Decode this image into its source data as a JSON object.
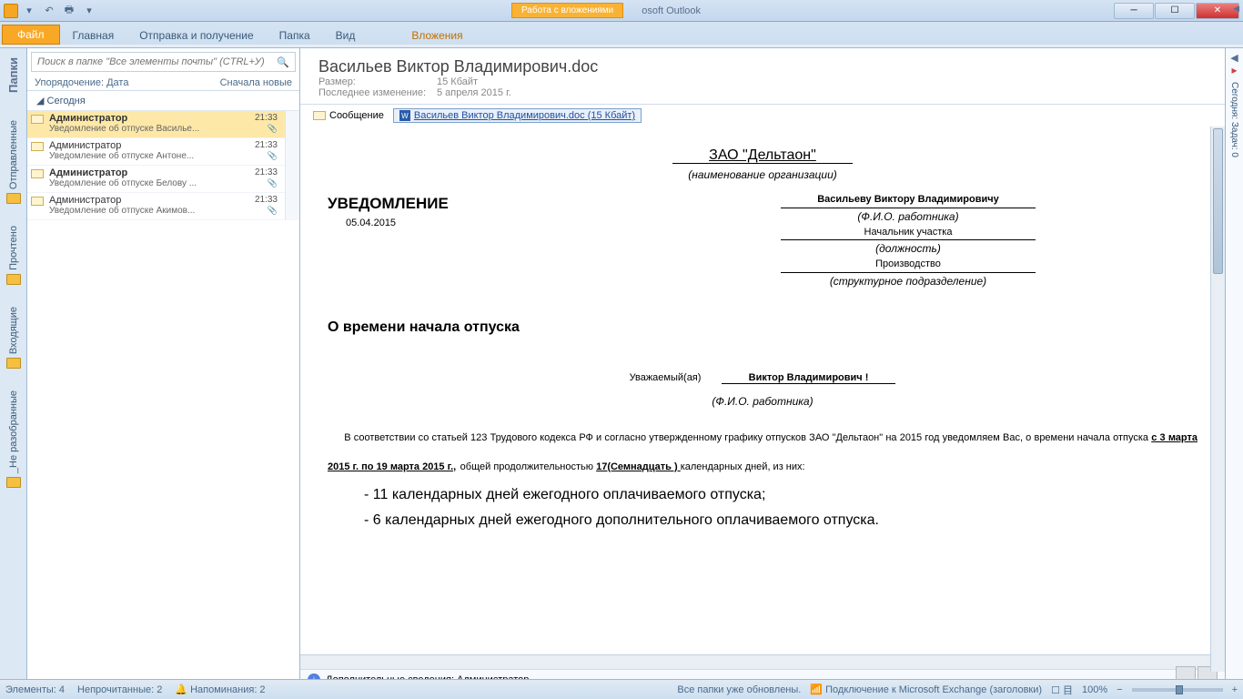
{
  "titlebar": {
    "attach_context": "Работа с вложениями",
    "window_title_suffix": "osoft Outlook"
  },
  "ribbon": {
    "file": "Файл",
    "home": "Главная",
    "sendrecv": "Отправка и получение",
    "folder": "Папка",
    "view": "Вид",
    "attachments": "Вложения"
  },
  "leftbar": {
    "header": "Папки",
    "items": [
      "Отправленные",
      "Прочтено",
      "Входящие",
      "_Не разобранные"
    ]
  },
  "midpane": {
    "search_placeholder": "Поиск в папке \"Все элементы почты\" (CTRL+У)",
    "sort_label": "Упорядочение: Дата",
    "sort_order": "Сначала новые",
    "group": "Сегодня",
    "messages": [
      {
        "from": "Администратор",
        "time": "21:33",
        "subj": "Уведомление об отпуске Василье...",
        "unread": true,
        "selected": true
      },
      {
        "from": "Администратор",
        "time": "21:33",
        "subj": "Уведомление об отпуске Антоне...",
        "unread": false
      },
      {
        "from": "Администратор",
        "time": "21:33",
        "subj": "Уведомление об отпуске Белову ...",
        "unread": true
      },
      {
        "from": "Администратор",
        "time": "21:33",
        "subj": "Уведомление об отпуске Акимов...",
        "unread": false
      }
    ]
  },
  "reading": {
    "title": "Васильев Виктор Владимирович.doc",
    "size_label": "Размер:",
    "size_value": "15 Кбайт",
    "mod_label": "Последнее изменение:",
    "mod_value": "5 апреля 2015 г.",
    "msg_btn": "Сообщение",
    "attachment": "Васильев Виктор Владимирович.doc (15 Кбайт)",
    "info": "Дополнительные сведения: Администратор."
  },
  "doc": {
    "org": "ЗАО \"Дельтаон\"",
    "org_caption": "(наименование организации)",
    "notice": "УВЕДОМЛЕНИЕ",
    "date": "05.04.2015",
    "to_name": "Васильеву Виктору Владимировичу",
    "to_name_cap": "(Ф.И.О. работника)",
    "position": "Начальник участка",
    "position_cap": "(должность)",
    "dept": "Производство",
    "dept_cap": "(структурное подразделение)",
    "subject": "О времени начала отпуска",
    "greeting": "Уважаемый(ая)",
    "greet_name": "Виктор Владимирович  !",
    "greet_cap": "(Ф.И.О. работника)",
    "body1": "В соответствии со статьей 123 Трудового кодекса РФ  и  согласно утвержденному графику  отпусков  ЗАО \"Дельтаон\"  на 2015 год  уведомляем  Вас, о   времени   начала  отпуска ",
    "period": "с  3  марта  2015 г.    по  19 марта 2015 г.,",
    "body2": " общей продолжительностью ",
    "duration": "  17(Семнадцать )  ",
    "body3": "  календарных дней, из них:",
    "l1": "- 11 календарных дней ежегодного оплачиваемого отпуска;",
    "l2": "- 6 календарных дней ежегодного дополнительного оплачиваемого отпуска."
  },
  "rightbar": {
    "label": "Сегодня: Задач: 0"
  },
  "status": {
    "elements": "Элементы: 4",
    "unread": "Непрочитанные: 2",
    "reminders": "Напоминания: 2",
    "folders": "Все папки уже обновлены.",
    "connection": "Подключение к Microsoft Exchange (заголовки)",
    "zoom": "100%"
  }
}
